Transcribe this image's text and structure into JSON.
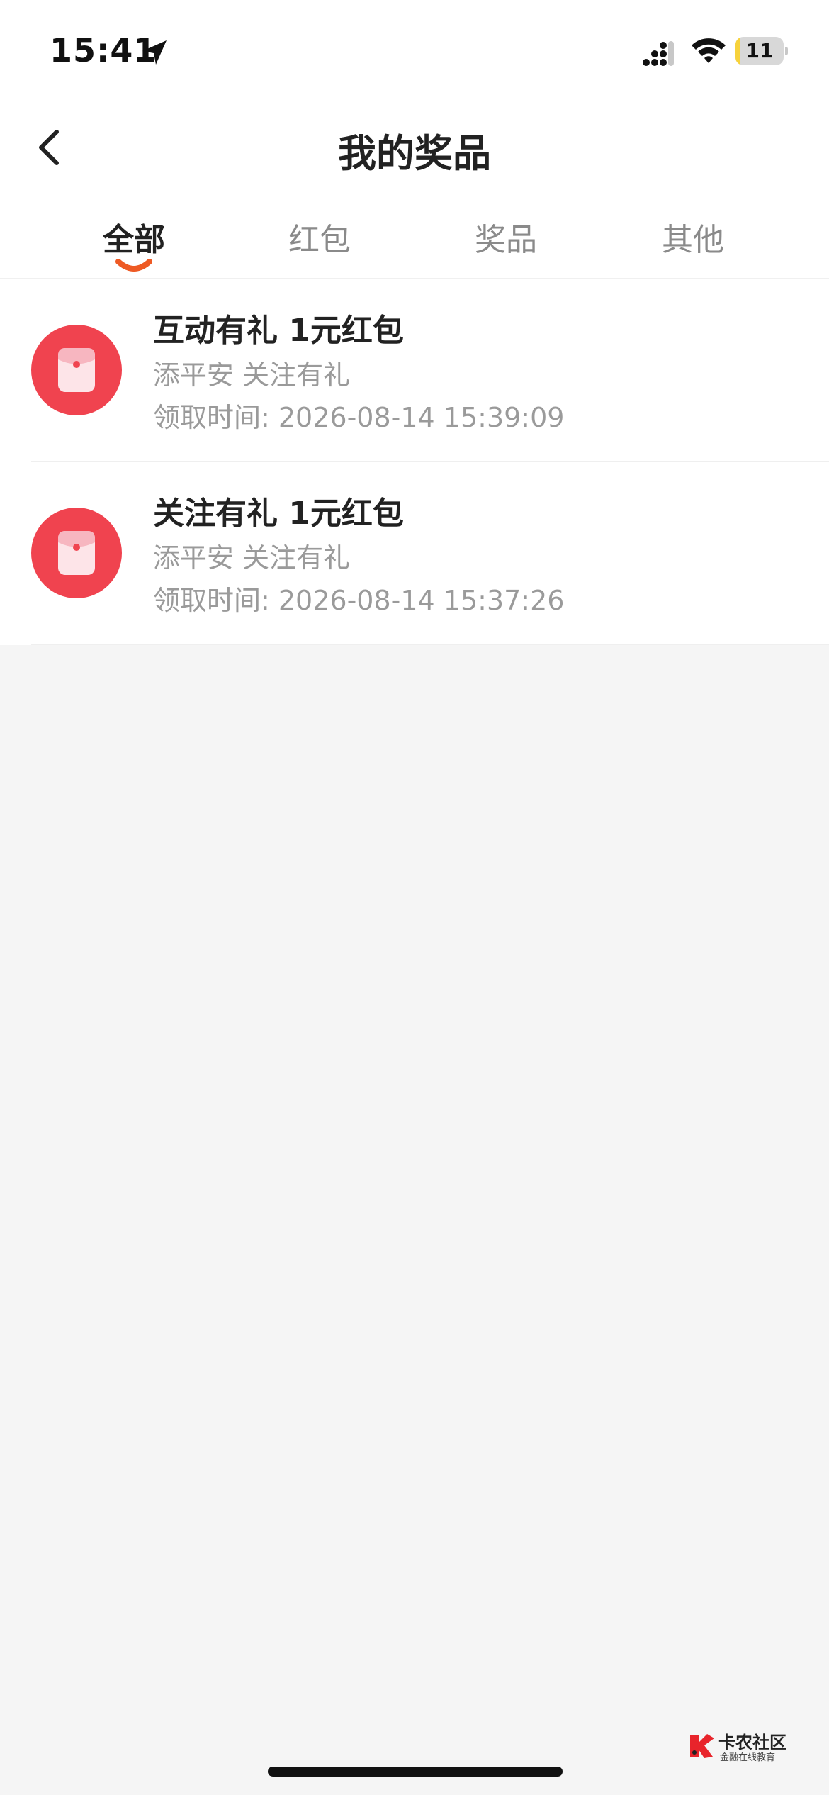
{
  "status_bar": {
    "time": "15:41",
    "battery_level": "11",
    "battery_fraction": 0.11,
    "location_icon": "location-arrow-icon",
    "signal_icon": "cellular-signal-icon",
    "wifi_icon": "wifi-icon"
  },
  "nav": {
    "title": "我的奖品",
    "back_icon": "chevron-left-icon"
  },
  "tabs": [
    {
      "label": "全部",
      "active": true
    },
    {
      "label": "红包",
      "active": false
    },
    {
      "label": "奖品",
      "active": false
    },
    {
      "label": "其他",
      "active": false
    }
  ],
  "prizes": [
    {
      "title": "互动有礼 1元红包",
      "source": "添平安 关注有礼",
      "time": "领取时间: 2026-08-14 15:39:09",
      "icon": "red-packet-icon"
    },
    {
      "title": "关注有礼 1元红包",
      "source": "添平安 关注有礼",
      "time": "领取时间: 2026-08-14 15:37:26",
      "icon": "red-packet-icon"
    }
  ],
  "watermark": {
    "title": "卡农社区",
    "subtitle": "金融在线教育"
  },
  "colors": {
    "accent": "#ee5a24",
    "red_packet": "#f0434f",
    "background": "#f5f5f5"
  }
}
